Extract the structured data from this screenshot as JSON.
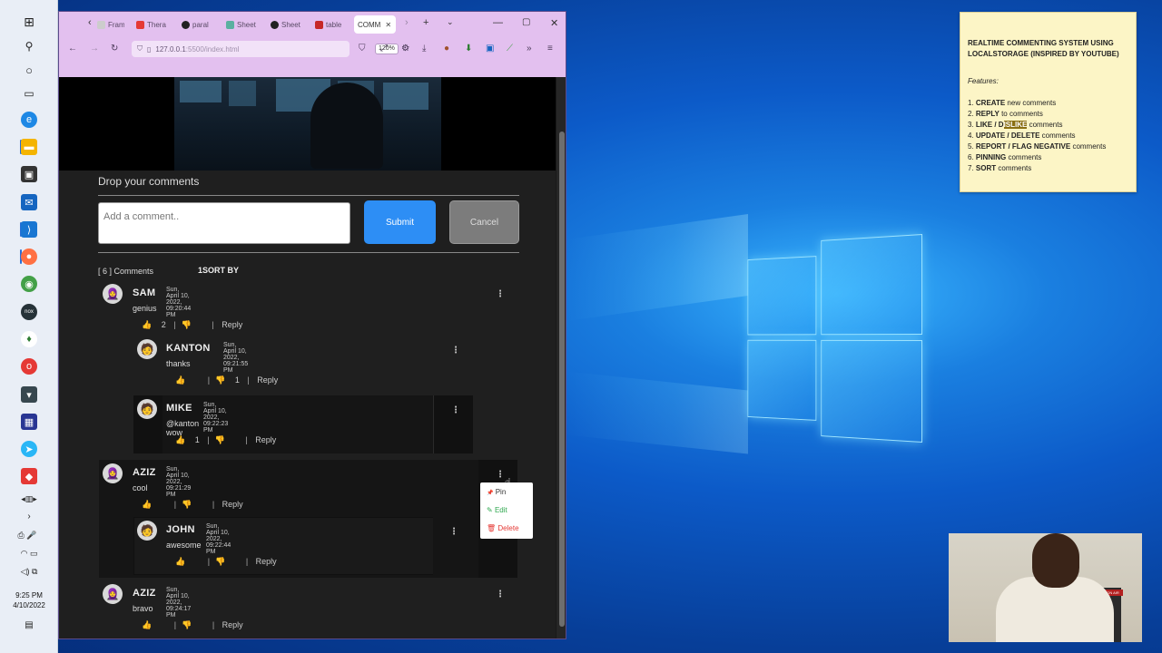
{
  "taskbar": {
    "time": "9:25 PM",
    "date": "4/10/2022",
    "apps": [
      "windows-start",
      "search",
      "cortana",
      "task-view",
      "edge",
      "file-explorer",
      "store",
      "mail",
      "vscode",
      "firefox",
      "chrome",
      "nox",
      "mongodb",
      "opera",
      "pocket",
      "thonny",
      "telegram",
      "anydesk"
    ]
  },
  "browser": {
    "tabs": [
      "Fram",
      "Thera",
      "paral",
      "Sheet",
      "Sheet",
      "table",
      "COMM"
    ],
    "url_host": "127.0.0.1",
    "url_path": ":5500/index.html",
    "zoom": "120%"
  },
  "page": {
    "section_title": "Drop your comments",
    "input_placeholder": "Add a comment..",
    "submit_label": "Submit",
    "cancel_label": "Cancel",
    "comment_count": "[ 6 ] Comments",
    "sort_label": "SORT BY",
    "sort_prefix": "1",
    "reply_label": "Reply"
  },
  "comments": [
    {
      "name": "SAM",
      "date": "Sun, April 10, 2022, 09:20:44 PM",
      "text": "genius",
      "likes": "2",
      "dislikes": ""
    },
    {
      "name": "KANTON",
      "date": "Sun, April 10, 2022, 09:21:55 PM",
      "text": "thanks",
      "likes": "",
      "dislikes": "1"
    },
    {
      "name": "MIKE",
      "date": "Sun, April 10, 2022, 09:22:23 PM",
      "text": "@kanton wow",
      "likes": "1",
      "dislikes": ""
    },
    {
      "name": "AZIZ",
      "date": "Sun, April 10, 2022, 09:21:29 PM",
      "text": "cool",
      "likes": "",
      "dislikes": ""
    },
    {
      "name": "JOHN",
      "date": "Sun, April 10, 2022, 09:22:44 PM",
      "text": "awesome",
      "likes": "",
      "dislikes": ""
    },
    {
      "name": "AZIZ",
      "date": "Sun, April 10, 2022, 09:24:17 PM",
      "text": "bravo",
      "likes": "",
      "dislikes": ""
    }
  ],
  "menu": {
    "pin": "Pin",
    "edit": "Edit",
    "delete": "Delete"
  },
  "note": {
    "title": "REALTIME COMMENTING SYSTEM USING LOCALSTORAGE (INSPIRED BY YOUTUBE)",
    "features_label": "Features",
    "f1_bold": "CREATE",
    "f1_rest": " new comments",
    "f2_bold": "REPLY",
    "f2_rest": " to comments",
    "f3_bold_a": "LIKE / D",
    "f3_hl": "ISLIKE",
    "f3_rest": " comments",
    "f4_bold": "UPDATE / DELETE",
    "f4_rest": " comments",
    "f5_bold": "REPORT / FLAG NEGATIVE",
    "f5_rest": " comments",
    "f6_bold": "PINNING",
    "f6_rest": " comments",
    "f7_bold": "SORT",
    "f7_rest": " comments"
  },
  "colors": {
    "accent": "#2d8ef5",
    "thumb": "#e6a521",
    "edit": "#2fa84f",
    "delete": "#e53935"
  }
}
